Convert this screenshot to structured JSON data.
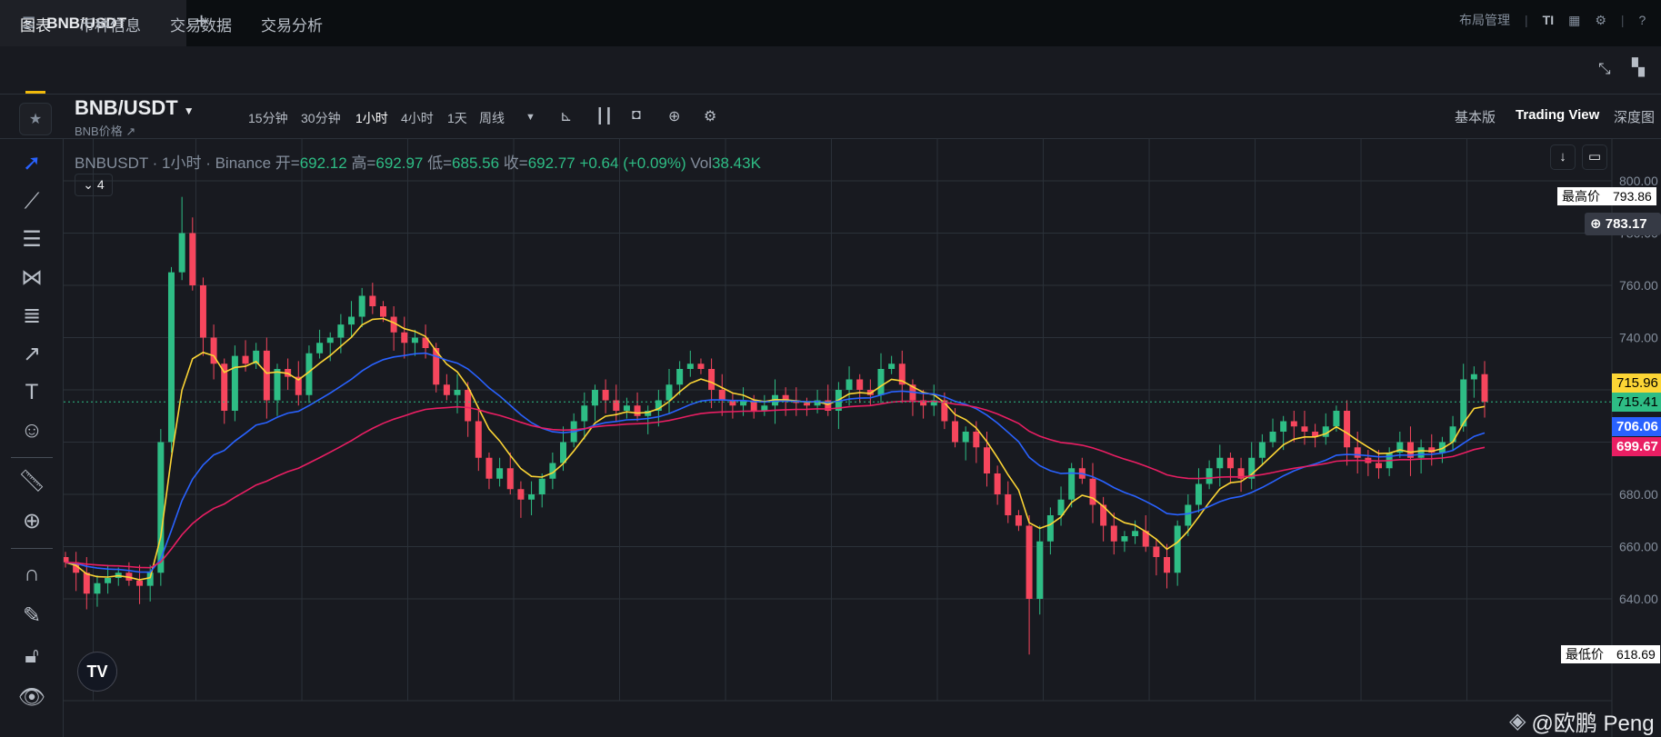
{
  "topbar": {
    "tab_title": "BNB/USDT",
    "new_tab": "+",
    "layout_label": "布局管理"
  },
  "nav": {
    "tabs": [
      {
        "label": "图表",
        "active": true
      },
      {
        "label": "币种信息"
      },
      {
        "label": "交易数据"
      },
      {
        "label": "交易分析"
      }
    ]
  },
  "toolbar": {
    "symbol": "BNB/USDT",
    "subtitle": "BNB价格 ↗",
    "intervals": [
      {
        "label": "15分钟"
      },
      {
        "label": "30分钟"
      },
      {
        "label": "1小时",
        "active": true
      },
      {
        "label": "4小时"
      },
      {
        "label": "1天"
      },
      {
        "label": "周线"
      }
    ],
    "views": [
      {
        "label": "基本版"
      },
      {
        "label": "Trading View",
        "active": true
      },
      {
        "label": "深度图"
      }
    ]
  },
  "legend": {
    "title": "BNBUSDT · 1小时 · Binance",
    "open_label": "开=",
    "open": "692.12",
    "high_label": "高=",
    "high": "692.97",
    "low_label": "低=",
    "low": "685.56",
    "close_label": "收=",
    "close": "692.77",
    "change": "+0.64 (+0.09%)",
    "vol_label": "Vol",
    "vol": "38.43K",
    "indicator_count": "4"
  },
  "colors": {
    "up": "#2ebd85",
    "down": "#f6465d",
    "ma_fast": "#fcd535",
    "ma_mid": "#2962ff",
    "ma_slow": "#e91e63"
  },
  "markers": {
    "high_label": "最高价",
    "high_value": "793.86",
    "low_label": "最低价",
    "low_value": "618.69",
    "crosshair_value": "783.17"
  },
  "watermark": "@欧鹏 Peng",
  "chart_data": {
    "type": "candlestick",
    "interval": "1h",
    "ylim": [
      600,
      810
    ],
    "yticks": [
      "640.00",
      "660.00",
      "680.00",
      "700.00",
      "720.00",
      "740.00",
      "760.00",
      "780.00",
      "800.00"
    ],
    "grid": true,
    "closes": [
      654,
      650,
      642,
      646,
      648,
      650,
      647,
      645,
      650,
      700,
      765,
      780,
      760,
      740,
      730,
      712,
      733,
      730,
      735,
      716,
      728,
      725,
      718,
      734,
      738,
      740,
      745,
      748,
      756,
      752,
      748,
      742,
      738,
      740,
      736,
      722,
      718,
      720,
      708,
      694,
      686,
      690,
      682,
      678,
      680,
      686,
      692,
      700,
      708,
      714,
      720,
      716,
      712,
      714,
      710,
      712,
      716,
      722,
      728,
      730,
      728,
      720,
      716,
      714,
      716,
      712,
      714,
      718,
      716,
      715,
      714,
      716,
      712,
      720,
      724,
      720,
      718,
      728,
      730,
      722,
      716,
      714,
      716,
      708,
      700,
      704,
      698,
      688,
      680,
      672,
      668,
      640,
      662,
      672,
      678,
      690,
      686,
      676,
      668,
      662,
      664,
      666,
      660,
      656,
      650,
      668,
      676,
      684,
      690,
      694,
      690,
      686,
      694,
      700,
      704,
      708,
      706,
      704,
      702,
      706,
      712,
      698,
      694,
      692,
      690,
      696,
      700,
      694,
      698,
      696,
      700,
      706,
      724,
      726,
      715.41
    ],
    "period_high": 793.86,
    "period_low": 618.69,
    "last_price": "715.41",
    "ma_last": [
      {
        "value": "715.96",
        "color": "#fcd535"
      },
      {
        "value": "706.06",
        "color": "#2962ff"
      },
      {
        "value": "699.67",
        "color": "#e91e63"
      }
    ]
  }
}
